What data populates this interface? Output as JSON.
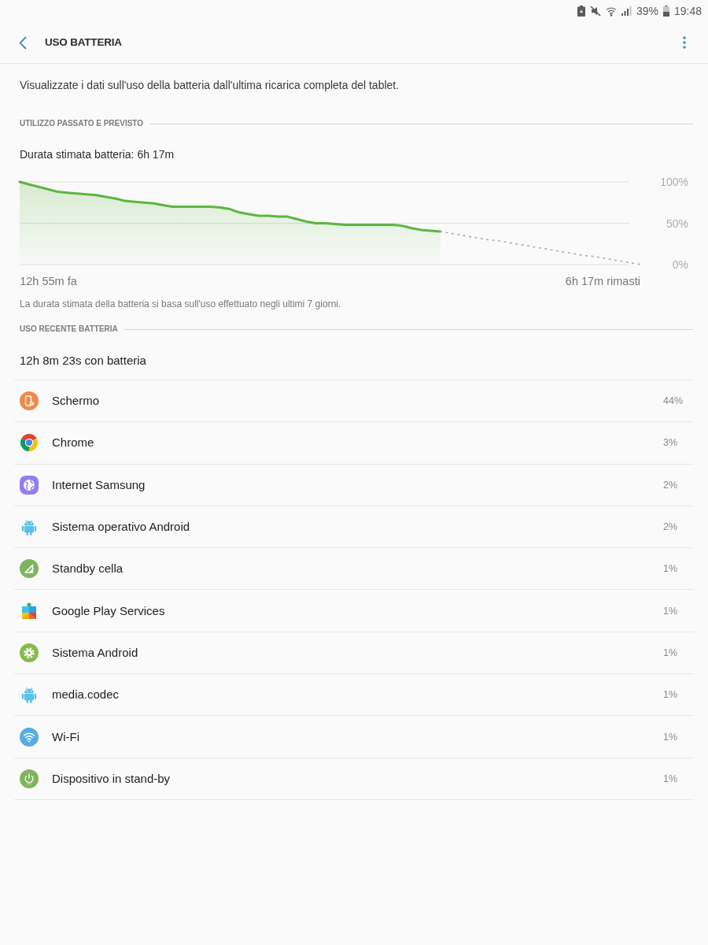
{
  "status_bar": {
    "battery": "39%",
    "time": "19:48"
  },
  "app_bar": {
    "title": "USO BATTERIA"
  },
  "description": "Visualizzate i dati sull'uso della batteria dall'ultima ricarica completa del tablet.",
  "past_and_forecast": {
    "heading": "UTILIZZO PASSATO E PREVISTO",
    "estimate": "Durata stimata batteria: 6h 17m",
    "chart_data": {
      "type": "area",
      "categories": [
        null,
        null,
        null,
        "12h 55m fa",
        null,
        null,
        null,
        null,
        null,
        null,
        null,
        null,
        null,
        null,
        null,
        null,
        null,
        null,
        null,
        null,
        null,
        null,
        null,
        null,
        null,
        null,
        null,
        null,
        null,
        null,
        null,
        null,
        null,
        null,
        null,
        null,
        null,
        null,
        null,
        null,
        null,
        null,
        null,
        null,
        null,
        null,
        null,
        null,
        null,
        null,
        null,
        null,
        null,
        null,
        null,
        null,
        null,
        null,
        null,
        null,
        null,
        "6h 17m rimasti",
        null,
        null,
        null,
        null
      ],
      "series": [
        {
          "color": "#5cb63f",
          "values": [
            100,
            97,
            94,
            91,
            88,
            87,
            86,
            85,
            84,
            82,
            80,
            77,
            76,
            75,
            74,
            72,
            70,
            70,
            70,
            70,
            70,
            69,
            67,
            63,
            61,
            59,
            59,
            58,
            58,
            55,
            52,
            50,
            50,
            49,
            48,
            48,
            48,
            48,
            48,
            48,
            47,
            44,
            42,
            41,
            40,
            null,
            null,
            null,
            null,
            null,
            null,
            null,
            null,
            null,
            null,
            null,
            null,
            null,
            null,
            null,
            null,
            null,
            null,
            null,
            null,
            null
          ]
        },
        {
          "type": "line",
          "line_style": "dotted",
          "color": "#a8a8a8",
          "values": [
            null,
            null,
            null,
            null,
            null,
            null,
            null,
            null,
            null,
            null,
            null,
            null,
            null,
            null,
            null,
            null,
            null,
            null,
            null,
            null,
            null,
            null,
            null,
            null,
            null,
            null,
            null,
            null,
            null,
            null,
            null,
            null,
            null,
            null,
            null,
            null,
            null,
            null,
            null,
            null,
            null,
            null,
            null,
            null,
            40,
            38,
            36,
            34,
            32,
            30,
            29,
            27,
            25,
            23,
            21,
            19,
            17,
            15,
            13,
            11,
            10,
            8,
            6,
            4,
            2,
            0
          ]
        }
      ],
      "ylim": [
        0,
        100
      ],
      "yticks": [
        {
          "value": 0,
          "label": "0%"
        },
        {
          "value": 50,
          "label": "50%"
        },
        {
          "value": 100,
          "label": "100%"
        }
      ]
    },
    "note": "La durata stimata della batteria si basa sull'uso effettuato negli ultimi 7 giorni."
  },
  "recent_usage": {
    "heading": "USO RECENTE BATTERIA",
    "on_battery": "12h 8m 23s con batteria",
    "items": [
      {
        "kind": "screen",
        "name": "Schermo",
        "percent": "44%"
      },
      {
        "kind": "ring",
        "name": "Chrome",
        "percent": "3%"
      },
      {
        "kind": "globe",
        "name": "Internet Samsung",
        "percent": "2%"
      },
      {
        "kind": "robot",
        "name": "Sistema operativo Android",
        "percent": "2%"
      },
      {
        "kind": "signal",
        "name": "Standby cella",
        "percent": "1%"
      },
      {
        "kind": "puzzle",
        "name": "Google Play Services",
        "percent": "1%"
      },
      {
        "kind": "gear",
        "name": "Sistema Android",
        "percent": "1%"
      },
      {
        "kind": "robot",
        "name": "media.codec",
        "percent": "1%"
      },
      {
        "kind": "wifi",
        "name": "Wi-Fi",
        "percent": "1%"
      },
      {
        "kind": "power",
        "name": "Dispositivo in stand-by",
        "percent": "1%"
      }
    ]
  }
}
